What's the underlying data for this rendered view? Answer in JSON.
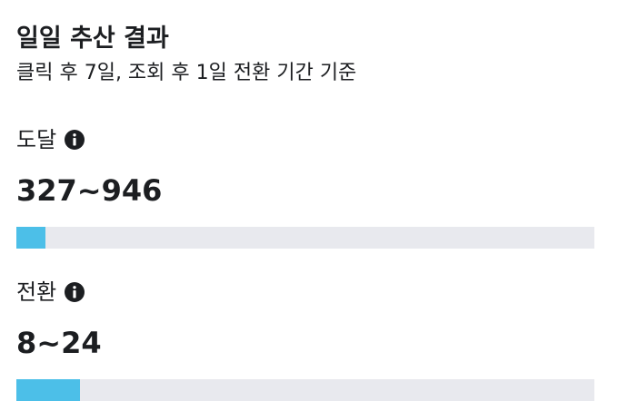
{
  "header": {
    "title": "일일 추산 결과",
    "subtitle": "클릭 후 7일, 조회 후 1일 전환 기간 기준"
  },
  "metrics": [
    {
      "label": "도달",
      "value": "327~946",
      "progress_fraction": 0.05,
      "info_icon": "info-circle-icon"
    },
    {
      "label": "전환",
      "value": "8~24",
      "progress_fraction": 0.11,
      "info_icon": "info-circle-icon"
    }
  ],
  "colors": {
    "bar_fill": "#4cbfe8",
    "bar_track": "#e8e9ee",
    "text": "#1c1e21",
    "icon": "#1c1e21"
  }
}
